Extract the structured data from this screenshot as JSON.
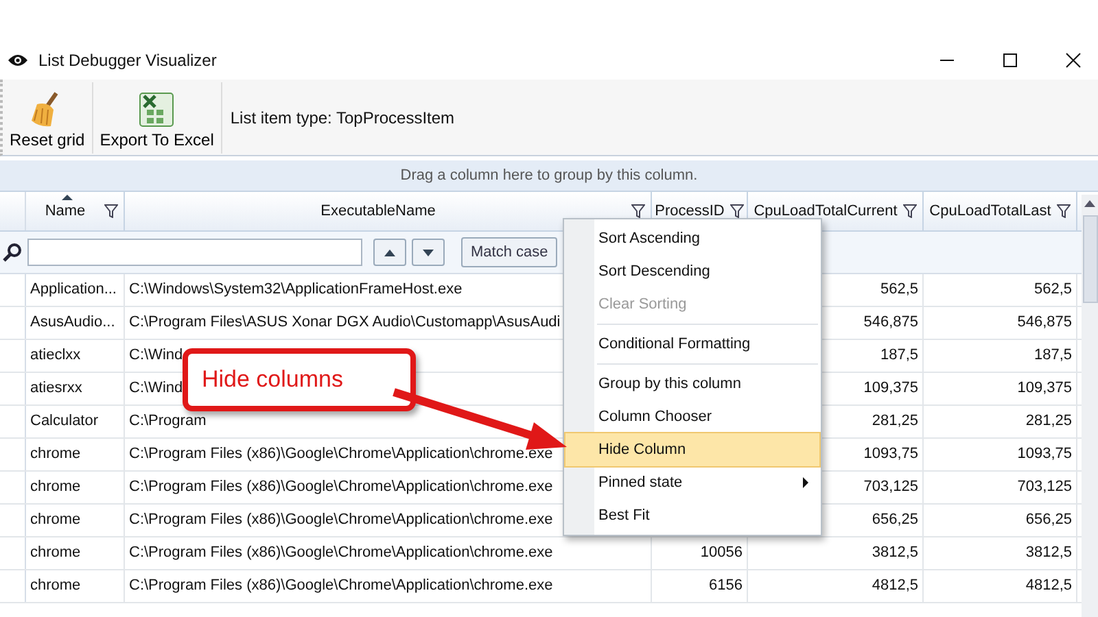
{
  "window": {
    "title": "List Debugger Visualizer"
  },
  "toolbar": {
    "buttons": [
      {
        "kind": "broom",
        "label": "Reset grid"
      },
      {
        "kind": "excel",
        "label": "Export To Excel"
      }
    ],
    "info": "List item type: TopProcessItem"
  },
  "group_panel": {
    "hint": "Drag a column here to group by this column."
  },
  "table": {
    "columns": [
      {
        "label": "Name",
        "sorted": true,
        "filter": true,
        "kind": "text"
      },
      {
        "label": "ExecutableName",
        "sorted": false,
        "filter": true,
        "kind": "text"
      },
      {
        "label": "ProcessID",
        "sorted": false,
        "filter": true,
        "kind": "number"
      },
      {
        "label": "CpuLoadTotalCurrent",
        "sorted": false,
        "filter": true,
        "kind": "number"
      },
      {
        "label": "CpuLoadTotalLast",
        "sorted": false,
        "filter": true,
        "kind": "number"
      }
    ],
    "search": {
      "match_case": "Match case"
    },
    "rows": [
      [
        "Application...",
        "C:\\Windows\\System32\\ApplicationFrameHost.exe",
        "",
        "562,5",
        "562,5"
      ],
      [
        "AsusAudio...",
        "C:\\Program Files\\ASUS Xonar DGX Audio\\Customapp\\AsusAudi",
        "",
        "546,875",
        "546,875"
      ],
      [
        "atieclxx",
        "C:\\Wind",
        "",
        "187,5",
        "187,5"
      ],
      [
        "atiesrxx",
        "C:\\Wind",
        "",
        "109,375",
        "109,375"
      ],
      [
        "Calculator",
        "C:\\Program",
        "",
        "281,25",
        "281,25"
      ],
      [
        "chrome",
        "C:\\Program Files (x86)\\Google\\Chrome\\Application\\chrome.exe",
        "",
        "1093,75",
        "1093,75"
      ],
      [
        "chrome",
        "C:\\Program Files (x86)\\Google\\Chrome\\Application\\chrome.exe",
        "",
        "703,125",
        "703,125"
      ],
      [
        "chrome",
        "C:\\Program Files (x86)\\Google\\Chrome\\Application\\chrome.exe",
        "",
        "656,25",
        "656,25"
      ],
      [
        "chrome",
        "C:\\Program Files (x86)\\Google\\Chrome\\Application\\chrome.exe",
        "10056",
        "3812,5",
        "3812,5"
      ],
      [
        "chrome",
        "C:\\Program Files (x86)\\Google\\Chrome\\Application\\chrome.exe",
        "6156",
        "4812,5",
        "4812,5"
      ]
    ]
  },
  "context_menu": {
    "items": [
      {
        "kind": "item",
        "label": "Sort Ascending",
        "disabled": false,
        "selected": false,
        "submenu": false
      },
      {
        "kind": "item",
        "label": "Sort Descending",
        "disabled": false,
        "selected": false,
        "submenu": false
      },
      {
        "kind": "item",
        "label": "Clear Sorting",
        "disabled": true,
        "selected": false,
        "submenu": false
      },
      {
        "kind": "separator"
      },
      {
        "kind": "item",
        "label": "Conditional Formatting",
        "disabled": false,
        "selected": false,
        "submenu": false
      },
      {
        "kind": "separator"
      },
      {
        "kind": "item",
        "label": "Group by this column",
        "disabled": false,
        "selected": false,
        "submenu": false
      },
      {
        "kind": "item",
        "label": "Column Chooser",
        "disabled": false,
        "selected": false,
        "submenu": false
      },
      {
        "kind": "item",
        "label": "Hide Column",
        "disabled": false,
        "selected": true,
        "submenu": false
      },
      {
        "kind": "item",
        "label": "Pinned state",
        "disabled": false,
        "selected": false,
        "submenu": true
      },
      {
        "kind": "item",
        "label": "Best Fit",
        "disabled": false,
        "selected": false,
        "submenu": false
      }
    ]
  },
  "callout": {
    "text": "Hide columns"
  }
}
